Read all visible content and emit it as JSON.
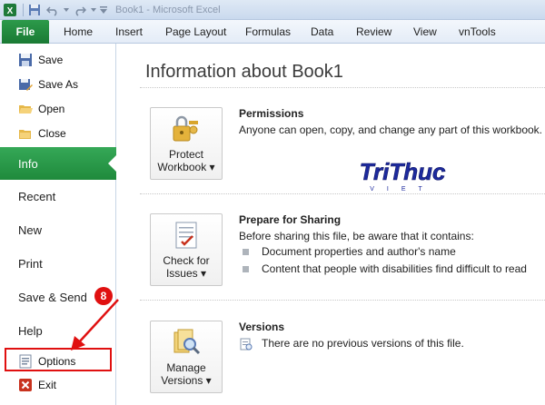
{
  "window": {
    "title": "Book1 - Microsoft Excel"
  },
  "ribbon": {
    "file_tab": "File",
    "tabs": [
      "Home",
      "Insert",
      "Page Layout",
      "Formulas",
      "Data",
      "Review",
      "View",
      "vnTools"
    ]
  },
  "nav": {
    "save": "Save",
    "save_as": "Save As",
    "open": "Open",
    "close": "Close",
    "info": "Info",
    "recent": "Recent",
    "new": "New",
    "print": "Print",
    "save_send": "Save & Send",
    "help": "Help",
    "options": "Options",
    "exit": "Exit"
  },
  "main": {
    "title": "Information about Book1",
    "permissions": {
      "button_line1": "Protect",
      "button_line2": "Workbook ▾",
      "heading": "Permissions",
      "text": "Anyone can open, copy, and change any part of this workbook."
    },
    "sharing": {
      "button_line1": "Check for",
      "button_line2": "Issues ▾",
      "heading": "Prepare for Sharing",
      "text": "Before sharing this file, be aware that it contains:",
      "items": [
        "Document properties and author's name",
        "Content that people with disabilities find difficult to read"
      ]
    },
    "versions": {
      "button_line1": "Manage",
      "button_line2": "Versions ▾",
      "heading": "Versions",
      "text": "There are no previous versions of this file."
    }
  },
  "watermark": {
    "text": "TriThuc",
    "sub": "VIET"
  },
  "annotation": {
    "step": "8"
  },
  "colors": {
    "file_green": "#1f8a3c",
    "highlight_red": "#e01010"
  }
}
